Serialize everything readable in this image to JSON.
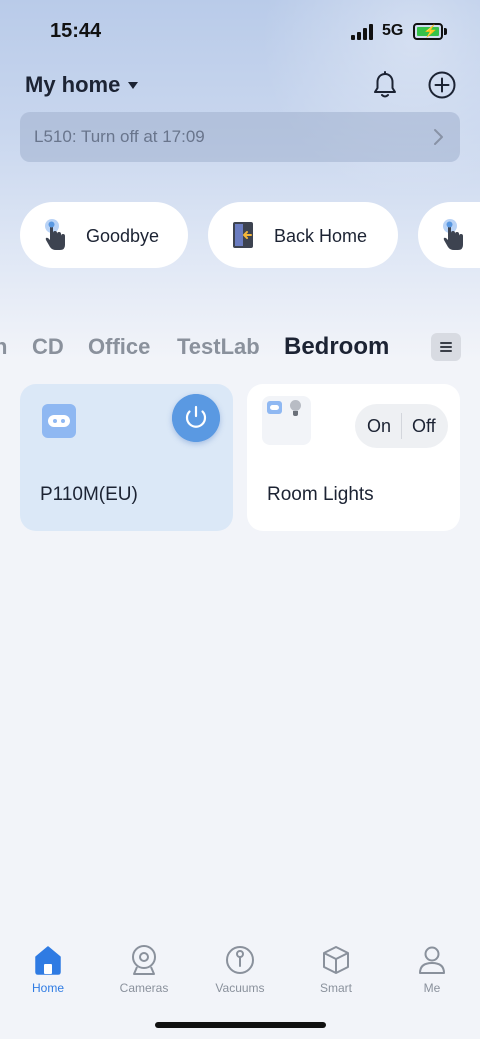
{
  "status_bar": {
    "time": "15:44",
    "network": "5G"
  },
  "header": {
    "title": "My home"
  },
  "notice": {
    "text": "L510: Turn off at 17:09"
  },
  "scenes": [
    {
      "label": "Goodbye"
    },
    {
      "label": "Back Home"
    },
    {
      "label": ""
    }
  ],
  "rooms": {
    "tabs": [
      {
        "label": "n"
      },
      {
        "label": "CD"
      },
      {
        "label": "Office"
      },
      {
        "label": "TestLab"
      },
      {
        "label": "Bedroom"
      }
    ],
    "active": "Bedroom"
  },
  "devices": [
    {
      "name": "P110M(EU)",
      "state": "on"
    },
    {
      "name": "Room Lights",
      "on_label": "On",
      "off_label": "Off"
    }
  ],
  "bottom_nav": {
    "items": [
      {
        "label": "Home"
      },
      {
        "label": "Cameras"
      },
      {
        "label": "Vacuums"
      },
      {
        "label": "Smart"
      },
      {
        "label": "Me"
      }
    ],
    "active": "Home"
  },
  "colors": {
    "accent": "#2f7be3",
    "power": "#5a99e2",
    "plug": "#8fb8f2"
  }
}
